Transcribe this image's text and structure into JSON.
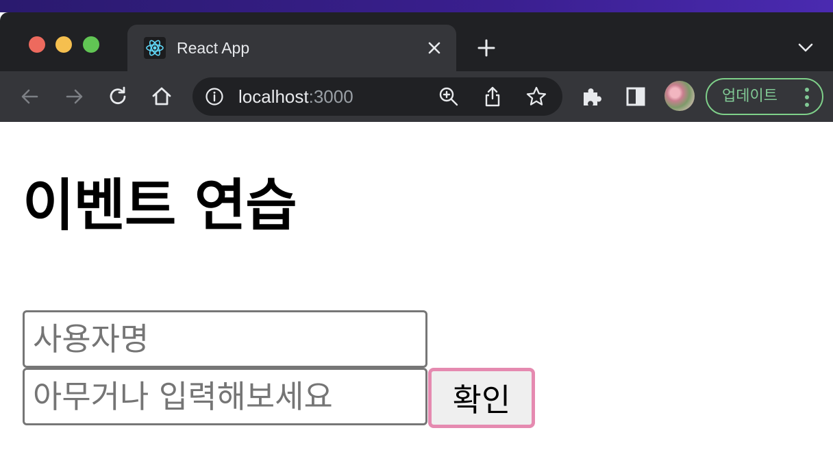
{
  "browser": {
    "tab": {
      "title": "React App",
      "favicon": "react-logo-icon"
    },
    "address": {
      "host": "localhost",
      "port": ":3000"
    },
    "update_button_label": "업데이트",
    "colors": {
      "chrome_dark": "#202124",
      "toolbar": "#35363a",
      "update_green": "#81c995"
    }
  },
  "page": {
    "heading": "이벤트 연습",
    "username_input": {
      "placeholder": "사용자명",
      "value": ""
    },
    "message_input": {
      "placeholder": "아무거나 입력해보세요",
      "value": ""
    },
    "confirm_button_label": "확인",
    "colors": {
      "button_border": "#e58ab0"
    }
  }
}
